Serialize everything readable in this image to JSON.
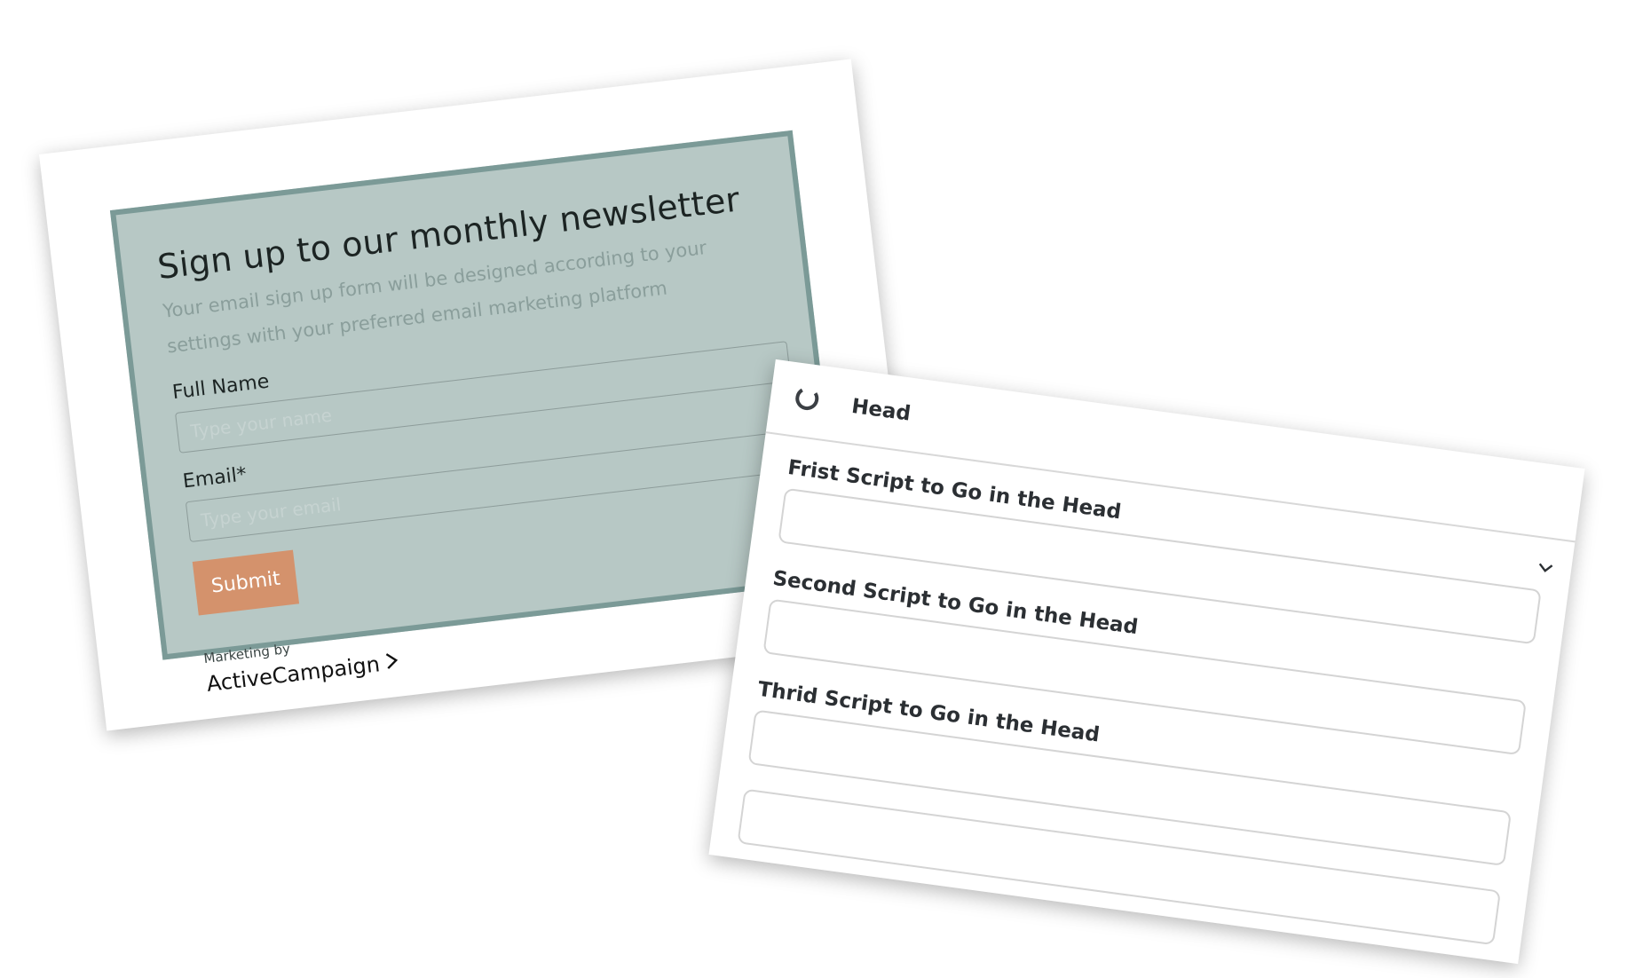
{
  "newsletter": {
    "title": "Sign up to our monthly newsletter",
    "description": "Your email sign up form will be designed according to your settings with your preferred email marketing platform",
    "fields": [
      {
        "label": "Full Name",
        "placeholder": "Type your name"
      },
      {
        "label": "Email*",
        "placeholder": "Type your email"
      }
    ],
    "submit_label": "Submit",
    "marketing_by": "Marketing by",
    "brand": "ActiveCampaign",
    "colors": {
      "panel_bg": "#b7c8c5",
      "panel_border": "#7b9a97",
      "submit_bg": "#d4926c"
    }
  },
  "head_panel": {
    "title": "Head",
    "header_icon": "loading-ring-icon",
    "toggle_icon": "chevron-down-icon",
    "scripts": [
      {
        "label": "Frist Script to Go in the Head",
        "value": ""
      },
      {
        "label": "Second Script to Go in the Head",
        "value": ""
      },
      {
        "label": "Thrid Script to Go in the Head",
        "value": ""
      }
    ]
  }
}
